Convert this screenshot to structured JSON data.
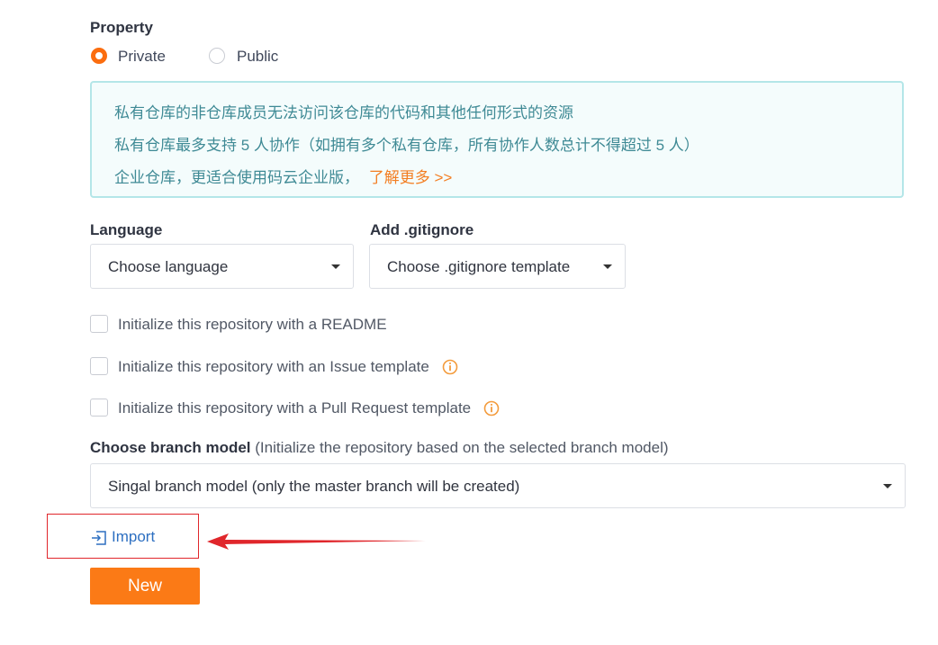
{
  "property": {
    "label": "Property",
    "options": [
      {
        "label": "Private",
        "selected": true
      },
      {
        "label": "Public",
        "selected": false
      }
    ]
  },
  "notice": {
    "line1": "私有仓库的非仓库成员无法访问该仓库的代码和其他任何形式的资源",
    "line2": "私有仓库最多支持 5 人协作（如拥有多个私有仓库，所有协作人数总计不得超过 5 人）",
    "line3_text": "企业仓库，更适合使用码云企业版，",
    "line3_link": "了解更多 >>"
  },
  "language": {
    "label": "Language",
    "value": "Choose language"
  },
  "gitignore": {
    "label": "Add .gitignore",
    "value": "Choose .gitignore template"
  },
  "checkboxes": [
    {
      "label": "Initialize this repository with a README",
      "checked": false
    },
    {
      "label": "Initialize this repository with an Issue template",
      "checked": false
    },
    {
      "label": "Initialize this repository with a Pull Request template",
      "checked": false
    }
  ],
  "branch": {
    "title": "Choose branch model",
    "hint": " (Initialize the repository based on the selected branch model)",
    "value": "Singal branch model (only the master branch will be created)"
  },
  "import": {
    "label": "Import",
    "icon": "import-icon"
  },
  "new_button": {
    "label": "New"
  },
  "colors": {
    "accent": "#fb7a16",
    "notice_bg": "#f4fcfc",
    "notice_text": "#3f8a95",
    "link": "#2d6fc1",
    "annotation": "#e0262b"
  }
}
